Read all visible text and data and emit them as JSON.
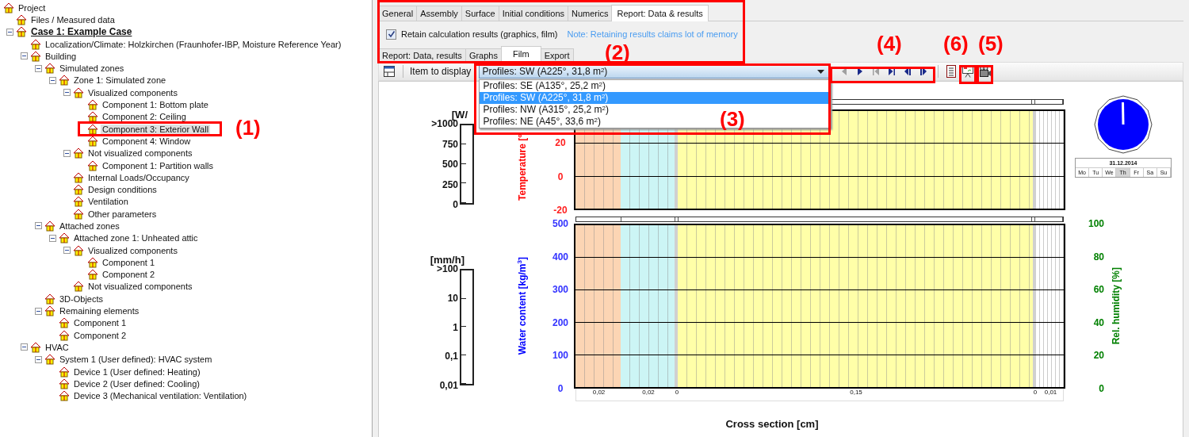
{
  "tree": {
    "label": "Project",
    "selected": false,
    "active": false,
    "children": [
      {
        "label": "Files / Measured data",
        "selected": false,
        "active": false
      },
      {
        "label": "Case 1: Example Case",
        "selected": false,
        "active": true,
        "expanded": true,
        "children": [
          {
            "label": "Localization/Climate: Holzkirchen (Fraunhofer-IBP, Moisture Reference Year)",
            "selected": false,
            "active": false
          },
          {
            "label": "Building",
            "selected": false,
            "active": false,
            "expanded": true,
            "children": [
              {
                "label": "Simulated zones",
                "selected": false,
                "active": false,
                "expanded": true,
                "children": [
                  {
                    "label": "Zone 1: Simulated zone",
                    "selected": false,
                    "active": false,
                    "expanded": true,
                    "children": [
                      {
                        "label": "Visualized components",
                        "selected": false,
                        "active": false,
                        "expanded": true,
                        "children": [
                          {
                            "label": "Component 1: Bottom plate",
                            "selected": false,
                            "active": false
                          },
                          {
                            "label": "Component 2: Ceiling",
                            "selected": false,
                            "active": false
                          },
                          {
                            "label": "Component 3: Exterior Wall",
                            "selected": true,
                            "active": false
                          },
                          {
                            "label": "Component 4: Window",
                            "selected": false,
                            "active": false
                          }
                        ]
                      },
                      {
                        "label": "Not visualized components",
                        "selected": false,
                        "active": false,
                        "expanded": true,
                        "children": [
                          {
                            "label": "Component 1: Partition walls",
                            "selected": false,
                            "active": false
                          }
                        ]
                      },
                      {
                        "label": "Internal Loads/Occupancy",
                        "selected": false,
                        "active": false
                      },
                      {
                        "label": "Design conditions",
                        "selected": false,
                        "active": false
                      },
                      {
                        "label": "Ventilation",
                        "selected": false,
                        "active": false
                      },
                      {
                        "label": "Other parameters",
                        "selected": false,
                        "active": false
                      }
                    ]
                  }
                ]
              },
              {
                "label": "Attached zones",
                "selected": false,
                "active": false,
                "expanded": true,
                "children": [
                  {
                    "label": "Attached zone 1: Unheated attic",
                    "selected": false,
                    "active": false,
                    "expanded": true,
                    "children": [
                      {
                        "label": "Visualized components",
                        "selected": false,
                        "active": false,
                        "expanded": true,
                        "children": [
                          {
                            "label": "Component 1",
                            "selected": false,
                            "active": false
                          },
                          {
                            "label": "Component 2",
                            "selected": false,
                            "active": false
                          }
                        ]
                      },
                      {
                        "label": "Not visualized components",
                        "selected": false,
                        "active": false
                      }
                    ]
                  }
                ]
              },
              {
                "label": "3D-Objects",
                "selected": false,
                "active": false
              },
              {
                "label": "Remaining elements",
                "selected": false,
                "active": false,
                "expanded": true,
                "children": [
                  {
                    "label": "Component 1",
                    "selected": false,
                    "active": false
                  },
                  {
                    "label": "Component 2",
                    "selected": false,
                    "active": false
                  }
                ]
              }
            ]
          },
          {
            "label": "HVAC",
            "selected": false,
            "active": false,
            "expanded": true,
            "children": [
              {
                "label": "System 1 (User defined): HVAC system",
                "selected": false,
                "active": false,
                "expanded": true,
                "children": [
                  {
                    "label": "Device 1 (User defined: Heating)",
                    "selected": false,
                    "active": false
                  },
                  {
                    "label": "Device 2 (User defined: Cooling)",
                    "selected": false,
                    "active": false
                  },
                  {
                    "label": "Device 3 (Mechanical ventilation: Ventilation)",
                    "selected": false,
                    "active": false
                  }
                ]
              }
            ]
          }
        ]
      }
    ]
  },
  "tabs": [
    {
      "label": "General",
      "selected": false
    },
    {
      "label": "Assembly",
      "selected": false
    },
    {
      "label": "Surface",
      "selected": false
    },
    {
      "label": "Initial conditions",
      "selected": false
    },
    {
      "label": "Numerics",
      "selected": false
    },
    {
      "label": "Report: Data & results",
      "selected": true
    }
  ],
  "retain": {
    "label": "Retain calculation results (graphics, film)",
    "checked": true,
    "note": "Note: Retaining results claims lot of memory"
  },
  "subtabs": [
    {
      "label": "Report: Data, results",
      "selected": false
    },
    {
      "label": "Graphs",
      "selected": false
    },
    {
      "label": "Film",
      "selected": true
    },
    {
      "label": "Export",
      "selected": false
    }
  ],
  "toolbar": {
    "item_label": "Item to display",
    "dropdown": {
      "value": "Profiles: SW (A225°, 31,8 m$^{2}$)",
      "expanded": true,
      "options": [
        {
          "label": "Profiles: SE (A135°, 25,2 m$^{2}$)",
          "selected": false
        },
        {
          "label": "Profiles: SW (A225°, 31,8 m$^{2}$)",
          "selected": true
        },
        {
          "label": "Profiles: NW (A315°, 25,2 m$^{2}$)",
          "selected": false
        },
        {
          "label": "Profiles: NE (A45°, 33,6 m$^{2}$)",
          "selected": false
        }
      ]
    },
    "nav_buttons": [
      {
        "kind": "back",
        "disabled": true
      },
      {
        "kind": "play",
        "disabled": false
      },
      {
        "kind": "first",
        "disabled": true
      },
      {
        "kind": "last",
        "disabled": false
      },
      {
        "kind": "rewind",
        "disabled": false
      },
      {
        "kind": "forward",
        "disabled": false
      }
    ]
  },
  "radiation_scale": {
    "unit": "[W/",
    "ticks": [
      ">1000",
      "750",
      "500",
      "250",
      "0"
    ]
  },
  "rain_scale": {
    "unit": "[mm/h]",
    "ticks": [
      ">100",
      "10",
      "1",
      "0,1",
      "0,01"
    ]
  },
  "temperature_axis": {
    "title": "Temperature [°",
    "ticks": [
      "20",
      "0",
      "-20"
    ]
  },
  "water_axis": {
    "title": "Water content [kg/m$^{3}$]",
    "ticks": [
      "500",
      "400",
      "300",
      "200",
      "100",
      "0"
    ]
  },
  "humidity_axis": {
    "title": "Rel. humidity [%]",
    "ticks": [
      "100",
      "80",
      "60",
      "40",
      "20",
      "0"
    ]
  },
  "layers": [
    {
      "thickness": "0,02",
      "color": "#fcd5b4"
    },
    {
      "thickness": "0,02",
      "color": "#ccf5f5"
    },
    {
      "thickness": "0",
      "color": "#d0d0d0"
    },
    {
      "thickness": "0,15",
      "color": "#ffffa8"
    },
    {
      "thickness": "0",
      "color": "#d0d0d0"
    },
    {
      "thickness": "0,01",
      "color": "#ffffff"
    }
  ],
  "x_axis_title": "Cross section [cm]",
  "calendar": {
    "date": "31.12.2014",
    "days": [
      {
        "label": "Mo",
        "selected": false
      },
      {
        "label": "Tu",
        "selected": false
      },
      {
        "label": "We",
        "selected": false
      },
      {
        "label": "Th",
        "selected": true
      },
      {
        "label": "Fr",
        "selected": false
      },
      {
        "label": "Sa",
        "selected": false
      },
      {
        "label": "Su",
        "selected": false
      }
    ]
  },
  "annotations": [
    {
      "label": "(1)"
    },
    {
      "label": "(2)"
    },
    {
      "label": "(3)"
    },
    {
      "label": "(4)"
    },
    {
      "label": "(6)"
    },
    {
      "label": "(5)"
    }
  ]
}
